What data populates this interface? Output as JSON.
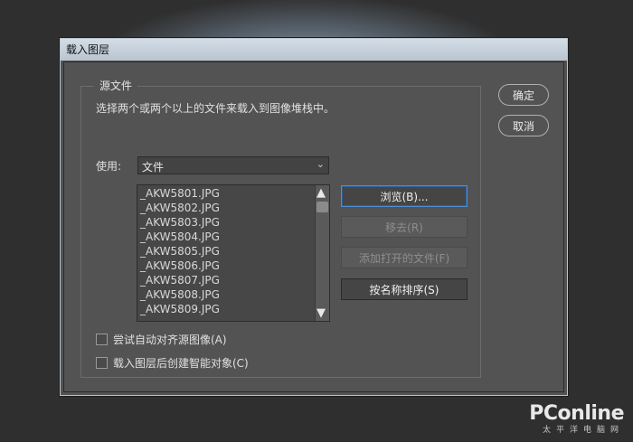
{
  "window": {
    "title": "载入图层"
  },
  "group": {
    "legend": "源文件",
    "description": "选择两个或两个以上的文件来载入到图像堆栈中。"
  },
  "use": {
    "label": "使用:",
    "selected": "文件"
  },
  "files": [
    "_AKW5801.JPG",
    "_AKW5802.JPG",
    "_AKW5803.JPG",
    "_AKW5804.JPG",
    "_AKW5805.JPG",
    "_AKW5806.JPG",
    "_AKW5807.JPG",
    "_AKW5808.JPG",
    "_AKW5809.JPG"
  ],
  "buttons": {
    "browse": "浏览(B)...",
    "remove": "移去(R)",
    "add_open": "添加打开的文件(F)",
    "sort_by_name": "按名称排序(S)",
    "ok": "确定",
    "cancel": "取消"
  },
  "options": {
    "auto_align": {
      "label": "尝试自动对齐源图像(A)",
      "checked": false
    },
    "smart_object": {
      "label": "载入图层后创建智能对象(C)",
      "checked": false
    }
  },
  "watermark": {
    "brand": "PConline",
    "sub": "太平洋电脑网"
  },
  "colors": {
    "dialog_bg": "#535353",
    "titlebar": "#c6d0da",
    "focus": "#4d8ed6"
  }
}
